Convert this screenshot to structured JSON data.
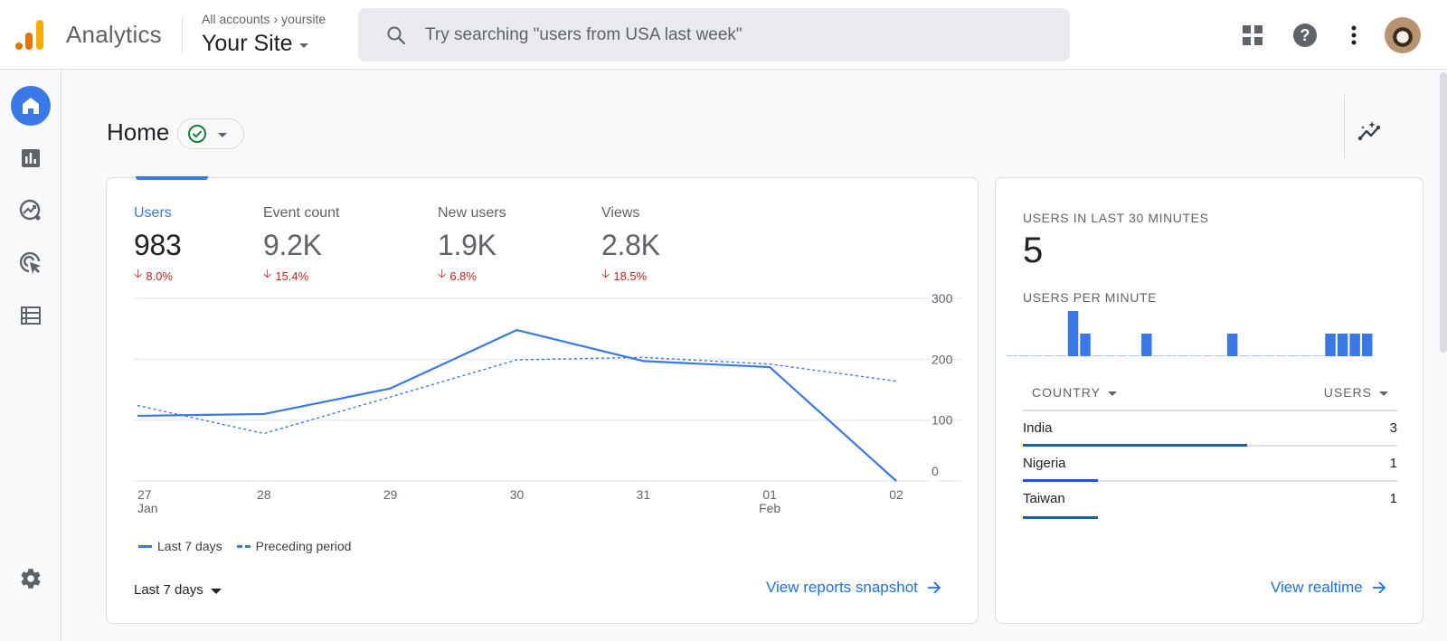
{
  "header": {
    "app_name": "Analytics",
    "breadcrumb": {
      "root": "All accounts",
      "separator": "›",
      "property": "yoursite"
    },
    "site_name": "Your Site",
    "search_placeholder": "Try searching \"users from USA last week\"",
    "icons": [
      "apps-grid-icon",
      "help-icon",
      "more-vert-icon",
      "account-avatar"
    ]
  },
  "sidebar": {
    "items": [
      {
        "name": "home",
        "icon": "home-icon",
        "active": true
      },
      {
        "name": "reports",
        "icon": "bar-chart-icon",
        "active": false
      },
      {
        "name": "explore",
        "icon": "explore-trend-icon",
        "active": false
      },
      {
        "name": "advertising",
        "icon": "target-cursor-icon",
        "active": false
      },
      {
        "name": "configure",
        "icon": "list-icon",
        "active": false
      }
    ],
    "settings_icon": "gear-icon"
  },
  "page": {
    "title": "Home",
    "status_icon": "check-circle-icon"
  },
  "overview": {
    "metrics": [
      {
        "label": "Users",
        "value": "983",
        "delta": "8.0%",
        "direction": "down",
        "active": true
      },
      {
        "label": "Event count",
        "value": "9.2K",
        "delta": "15.4%",
        "direction": "down",
        "active": false
      },
      {
        "label": "New users",
        "value": "1.9K",
        "delta": "6.8%",
        "direction": "down",
        "active": false
      },
      {
        "label": "Views",
        "value": "2.8K",
        "delta": "18.5%",
        "direction": "down",
        "active": false
      }
    ],
    "date_range": "Last 7 days",
    "link": "View reports snapshot"
  },
  "chart_data": {
    "type": "line",
    "title": "",
    "xlabel": "",
    "ylabel": "Users",
    "x": [
      "27",
      "28",
      "29",
      "30",
      "31",
      "01",
      "02"
    ],
    "x_sublabels": [
      "Jan",
      "",
      "",
      "",
      "",
      "Feb",
      ""
    ],
    "ylim": [
      0,
      300
    ],
    "yticks": [
      0,
      100,
      200,
      300
    ],
    "ytick_labels": [
      "0",
      "100",
      "200",
      "300"
    ],
    "grid": true,
    "y_axis_position": "right",
    "legend_position": "bottom-left",
    "series": [
      {
        "name": "Last 7 days",
        "style": "solid",
        "color": "#3b78e7",
        "values": [
          107,
          110,
          152,
          248,
          197,
          187,
          0
        ]
      },
      {
        "name": "Preceding period",
        "style": "dashed",
        "color": "#3b78e7",
        "values": [
          124,
          78,
          138,
          199,
          203,
          192,
          164
        ]
      }
    ]
  },
  "realtime": {
    "title": "USERS IN LAST 30 MINUTES",
    "count": "5",
    "per_minute_label": "USERS PER MINUTE",
    "per_minute": [
      0,
      0,
      0,
      0,
      0,
      2,
      1,
      0,
      0,
      0,
      0,
      1,
      0,
      0,
      0,
      0,
      0,
      0,
      1,
      0,
      0,
      0,
      0,
      0,
      0,
      0,
      1,
      1,
      1,
      1
    ],
    "table": {
      "columns": [
        "COUNTRY",
        "USERS"
      ],
      "rows": [
        {
          "country": "India",
          "users": 3,
          "share": 0.6
        },
        {
          "country": "Nigeria",
          "users": 1,
          "share": 0.2
        },
        {
          "country": "Taiwan",
          "users": 1,
          "share": 0.2
        }
      ]
    },
    "link": "View realtime"
  },
  "colors": {
    "accent": "#3b78e7",
    "link": "#1a73e8",
    "negative": "#c5221f",
    "success": "#188038"
  }
}
